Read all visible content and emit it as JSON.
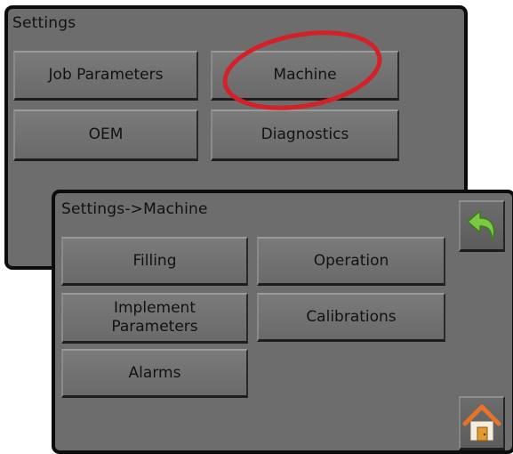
{
  "settings": {
    "title": "Settings",
    "buttons": [
      "Job Parameters",
      "Machine",
      "OEM",
      "Diagnostics"
    ]
  },
  "machine": {
    "title": "Settings->Machine",
    "buttons": {
      "filling": "Filling",
      "operation": "Operation",
      "implement_line1": "Implement",
      "implement_line2": "Parameters",
      "calibrations": "Calibrations",
      "alarms": "Alarms"
    }
  },
  "icons": {
    "back": "back-arrow-icon",
    "home": "home-icon"
  },
  "colors": {
    "panel": "#6d6d6d",
    "highlight": "#d42127",
    "back_arrow": "#7ac943",
    "home_roof": "#e8722a",
    "home_door": "#e39b2f"
  }
}
